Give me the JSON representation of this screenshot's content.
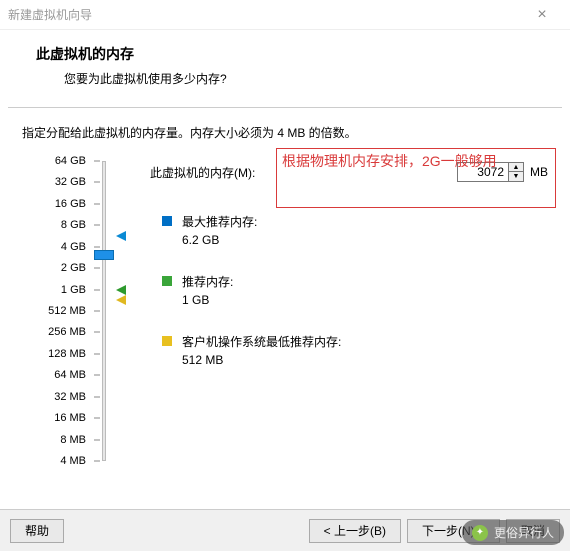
{
  "window": {
    "title": "新建虚拟机向导"
  },
  "header": {
    "title": "此虚拟机的内存",
    "subtitle": "您要为此虚拟机使用多少内存?"
  },
  "instruction": "指定分配给此虚拟机的内存量。内存大小必须为 4 MB 的倍数。",
  "memory": {
    "label": "此虚拟机的内存(M):",
    "value": "3072",
    "unit": "MB"
  },
  "slider": {
    "ticks": [
      "64 GB",
      "32 GB",
      "16 GB",
      "8 GB",
      "4 GB",
      "2 GB",
      "1 GB",
      "512 MB",
      "256 MB",
      "128 MB",
      "64 MB",
      "32 MB",
      "16 MB",
      "8 MB",
      "4 MB"
    ],
    "thumb_index": 4.4
  },
  "markers": {
    "max": {
      "label": "最大推荐内存:",
      "value": "6.2 GB",
      "color": "blue",
      "tick_index": 3.5
    },
    "rec": {
      "label": "推荐内存:",
      "value": "1 GB",
      "color": "green",
      "tick_index": 6
    },
    "min": {
      "label": "客户机操作系统最低推荐内存:",
      "value": "512 MB",
      "color": "yellow",
      "tick_index": 6.5
    }
  },
  "annotation": "根据物理机内存安排，2G一般够用",
  "buttons": {
    "help": "帮助",
    "back": "< 上一步(B)",
    "next": "下一步(N) >",
    "cancel": "取消"
  },
  "watermark": "更俗异行人"
}
